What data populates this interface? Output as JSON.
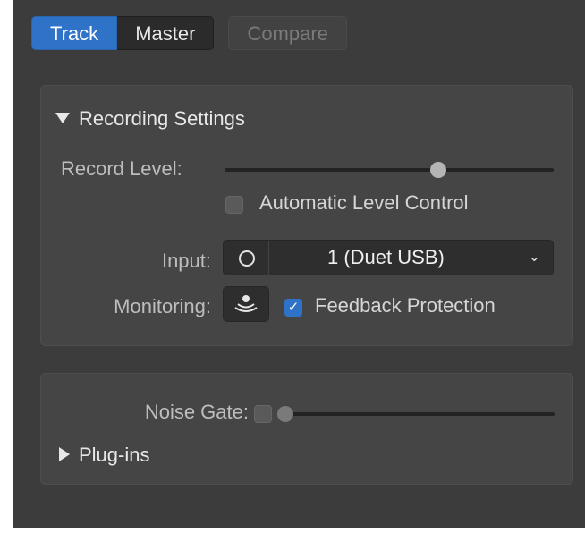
{
  "tabs": {
    "track": "Track",
    "master": "Master",
    "compare": "Compare"
  },
  "recording": {
    "title": "Recording Settings",
    "record_level_label": "Record Level:",
    "record_level": 0.65,
    "auto_level_label": "Automatic Level Control",
    "auto_level_checked": false,
    "input_label": "Input:",
    "input_value": "1  (Duet USB)",
    "monitoring_label": "Monitoring:",
    "feedback_label": "Feedback Protection",
    "feedback_checked": true
  },
  "gate": {
    "noise_gate_label": "Noise Gate:",
    "noise_gate_checked": false,
    "noise_gate_level": 0.0,
    "plugins_label": "Plug-ins"
  },
  "icons": {
    "chevron": "chevron-down-icon",
    "ring": "mono-input-icon",
    "monitor": "monitoring-icon",
    "check": "checkmark-icon"
  }
}
